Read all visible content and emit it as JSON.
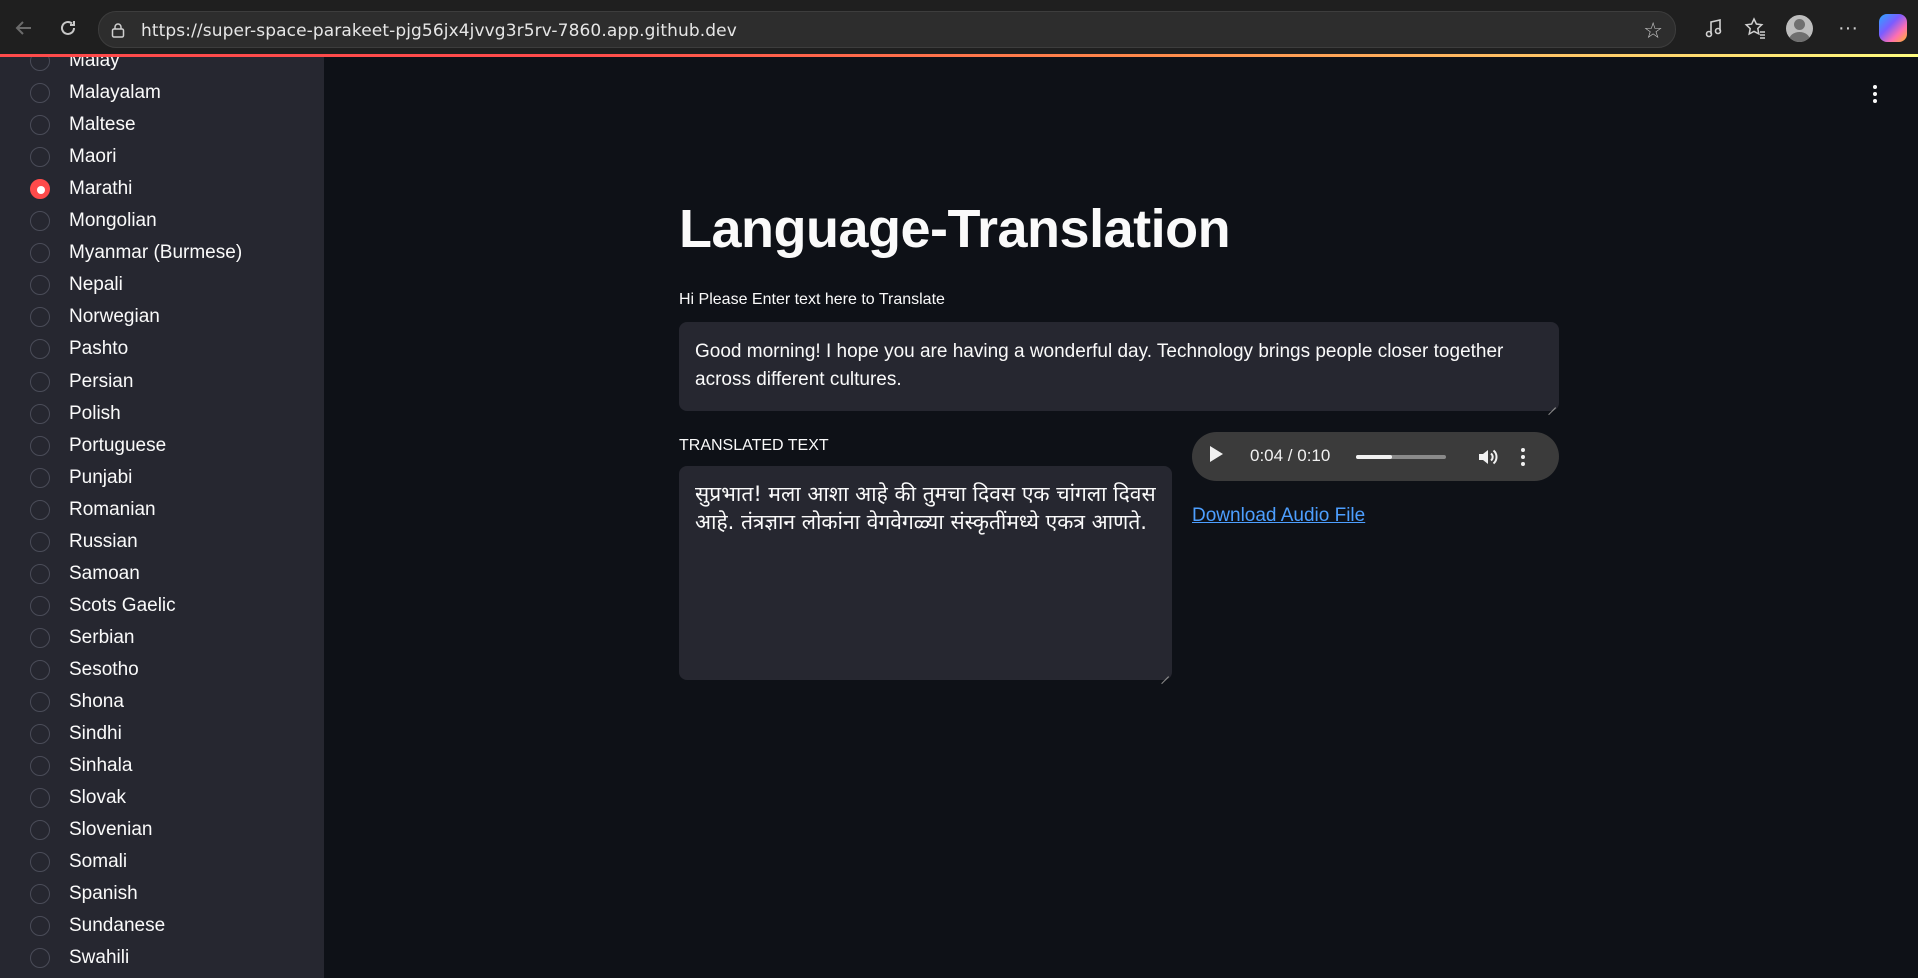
{
  "browser": {
    "url": "https://super-space-parakeet-pjg56jx4jvvg3r5rv-7860.app.github.dev"
  },
  "sidebar": {
    "selected": "Marathi",
    "items": [
      {
        "label": "Malay",
        "selected": false
      },
      {
        "label": "Malayalam",
        "selected": false
      },
      {
        "label": "Maltese",
        "selected": false
      },
      {
        "label": "Maori",
        "selected": false
      },
      {
        "label": "Marathi",
        "selected": true
      },
      {
        "label": "Mongolian",
        "selected": false
      },
      {
        "label": "Myanmar (Burmese)",
        "selected": false
      },
      {
        "label": "Nepali",
        "selected": false
      },
      {
        "label": "Norwegian",
        "selected": false
      },
      {
        "label": "Pashto",
        "selected": false
      },
      {
        "label": "Persian",
        "selected": false
      },
      {
        "label": "Polish",
        "selected": false
      },
      {
        "label": "Portuguese",
        "selected": false
      },
      {
        "label": "Punjabi",
        "selected": false
      },
      {
        "label": "Romanian",
        "selected": false
      },
      {
        "label": "Russian",
        "selected": false
      },
      {
        "label": "Samoan",
        "selected": false
      },
      {
        "label": "Scots Gaelic",
        "selected": false
      },
      {
        "label": "Serbian",
        "selected": false
      },
      {
        "label": "Sesotho",
        "selected": false
      },
      {
        "label": "Shona",
        "selected": false
      },
      {
        "label": "Sindhi",
        "selected": false
      },
      {
        "label": "Sinhala",
        "selected": false
      },
      {
        "label": "Slovak",
        "selected": false
      },
      {
        "label": "Slovenian",
        "selected": false
      },
      {
        "label": "Somali",
        "selected": false
      },
      {
        "label": "Spanish",
        "selected": false
      },
      {
        "label": "Sundanese",
        "selected": false
      },
      {
        "label": "Swahili",
        "selected": false
      }
    ]
  },
  "main": {
    "title": "Language-Translation",
    "input_label": "Hi Please Enter text here to Translate",
    "input_value": "Good morning! I hope you are having a wonderful day. Technology brings people closer together across different cultures.",
    "output_label": "TRANSLATED TEXT",
    "output_value": "सुप्रभात! मला आशा आहे की तुमचा दिवस एक चांगला दिवस आहे. तंत्रज्ञान लोकांना वेगवेगळ्या संस्कृतींमध्ये एकत्र आणते.",
    "audio": {
      "time": "0:04 / 0:10",
      "progress": 0.4
    },
    "download_label": "Download Audio File"
  },
  "colors": {
    "accent": "#ff4b4b",
    "link": "#4d9fff",
    "background": "#0e1117",
    "sidebar": "#262730"
  }
}
